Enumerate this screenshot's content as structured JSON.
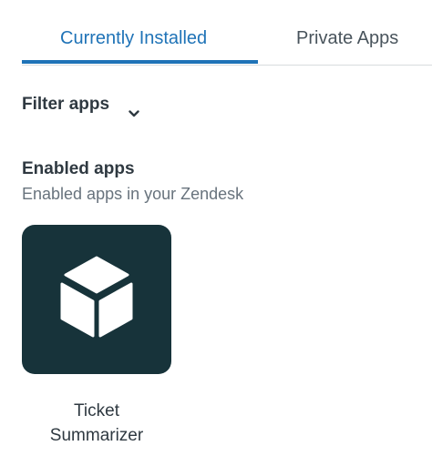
{
  "tabs": [
    {
      "label": "Currently Installed",
      "active": true
    },
    {
      "label": "Private Apps",
      "active": false
    }
  ],
  "filter": {
    "label": "Filter apps",
    "icon": "chevron-down-icon"
  },
  "section": {
    "title": "Enabled apps",
    "subtitle": "Enabled apps in your Zendesk"
  },
  "apps": [
    {
      "name_line1": "Ticket",
      "name_line2": "Summarizer",
      "icon": "cube-icon",
      "tile_color": "#17333a"
    }
  ],
  "colors": {
    "accent": "#1f73b7",
    "text": "#2f3941",
    "muted": "#68737d"
  }
}
